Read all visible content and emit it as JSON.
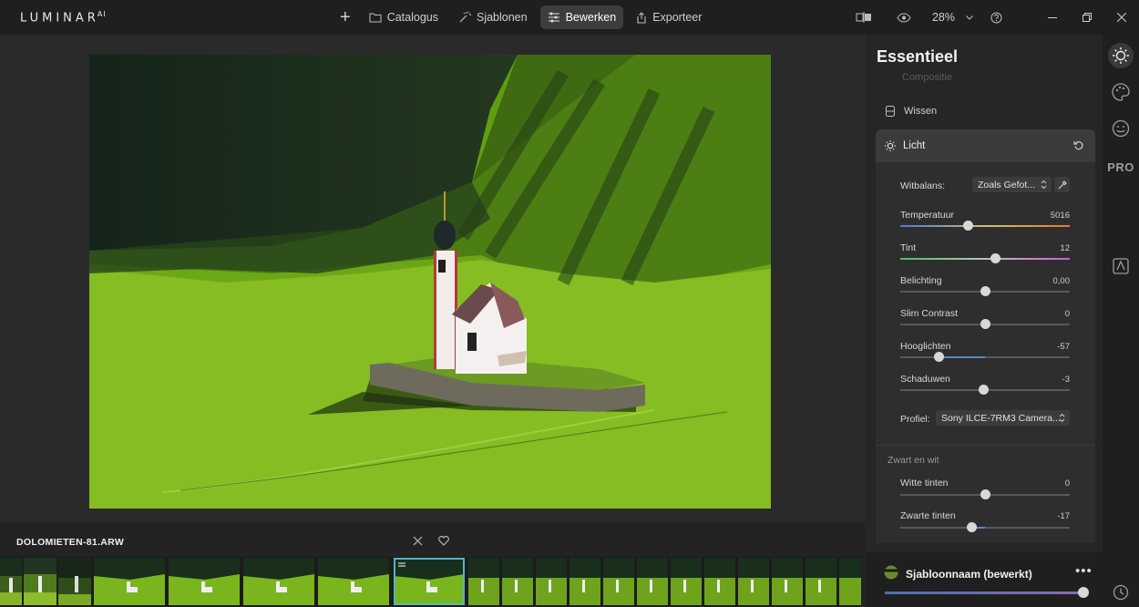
{
  "app": {
    "logo_text": "LUMINAR",
    "logo_sup": "AI"
  },
  "nav": {
    "add_label": "+",
    "items": [
      {
        "label": "Catalogus",
        "icon": "folder-icon"
      },
      {
        "label": "Sjablonen",
        "icon": "magic-wand-icon"
      },
      {
        "label": "Bewerken",
        "icon": "sliders-icon",
        "active": true
      },
      {
        "label": "Exporteer",
        "icon": "export-icon"
      }
    ]
  },
  "topbar": {
    "zoom": "28%"
  },
  "file": {
    "name": "DOLOMIETEN-81.ARW"
  },
  "panel": {
    "title": "Essentieel",
    "faded_item": "Compositie",
    "wissen_label": "Wissen",
    "licht_label": "Licht",
    "whitebalance": {
      "label": "Witbalans:",
      "value": "Zoals Gefot..."
    },
    "sliders": [
      {
        "label": "Temperatuur",
        "value": "5016",
        "level": 0.4
      },
      {
        "label": "Tint",
        "value": "12",
        "level": 0.56
      },
      {
        "label": "Belichting",
        "value": "0,00",
        "level": 0.5
      },
      {
        "label": "Slim Contrast",
        "value": "0",
        "level": 0.5
      },
      {
        "label": "Hooglichten",
        "value": "-57",
        "level": 0.23
      },
      {
        "label": "Schaduwen",
        "value": "-3",
        "level": 0.49
      }
    ],
    "profile": {
      "label": "Profiel:",
      "value": "Sony ILCE-7RM3 Camera..."
    },
    "bw_section": "Zwart en wit",
    "bw_sliders": [
      {
        "label": "Witte tinten",
        "value": "0",
        "level": 0.5
      },
      {
        "label": "Zwarte tinten",
        "value": "-17",
        "level": 0.42
      }
    ]
  },
  "rail": {
    "pro_label": "PRO"
  },
  "preset": {
    "name": "Sjabloonnaam (bewerkt)",
    "menu": "•••"
  },
  "colors": {
    "accent_selected": "#4fb6c9",
    "grass": "#7fb21e",
    "forest": "#1a2e1c"
  }
}
